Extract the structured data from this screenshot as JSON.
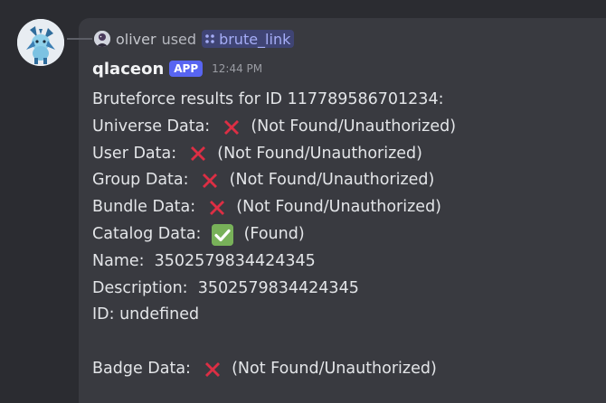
{
  "reply": {
    "user": "oliver",
    "used_text": "used",
    "command": "brute_link"
  },
  "message": {
    "author": "qlaceon",
    "badge": "APP",
    "timestamp": "12:44 PM"
  },
  "content": {
    "line_intro": "Bruteforce results for ID 117789586701234:",
    "universe_label": "Universe Data: ",
    "universe_status": " (Not Found/Unauthorized)",
    "user_label": "User Data: ",
    "user_status": " (Not Found/Unauthorized)",
    "group_label": "Group Data: ",
    "group_status": " (Not Found/Unauthorized)",
    "bundle_label": "Bundle Data: ",
    "bundle_status": " (Not Found/Unauthorized)",
    "catalog_label": "Catalog Data: ",
    "catalog_status": " (Found)",
    "name_line": "Name:  3502579834424345",
    "description_line": "Description:  3502579834424345",
    "id_line": "ID: undefined",
    "badge_label": "Badge Data: ",
    "badge_status": " (Not Found/Unauthorized)"
  },
  "icons": {
    "not_found": "cross-mark-icon",
    "found": "check-mark-button-icon",
    "command": "slash-command-icon"
  },
  "colors": {
    "background": "#2b2c31",
    "card": "#393a40",
    "cross": "#dd2e44",
    "check": "#78b159",
    "app_badge": "#5865f2",
    "command_pill": "#3f4474"
  }
}
